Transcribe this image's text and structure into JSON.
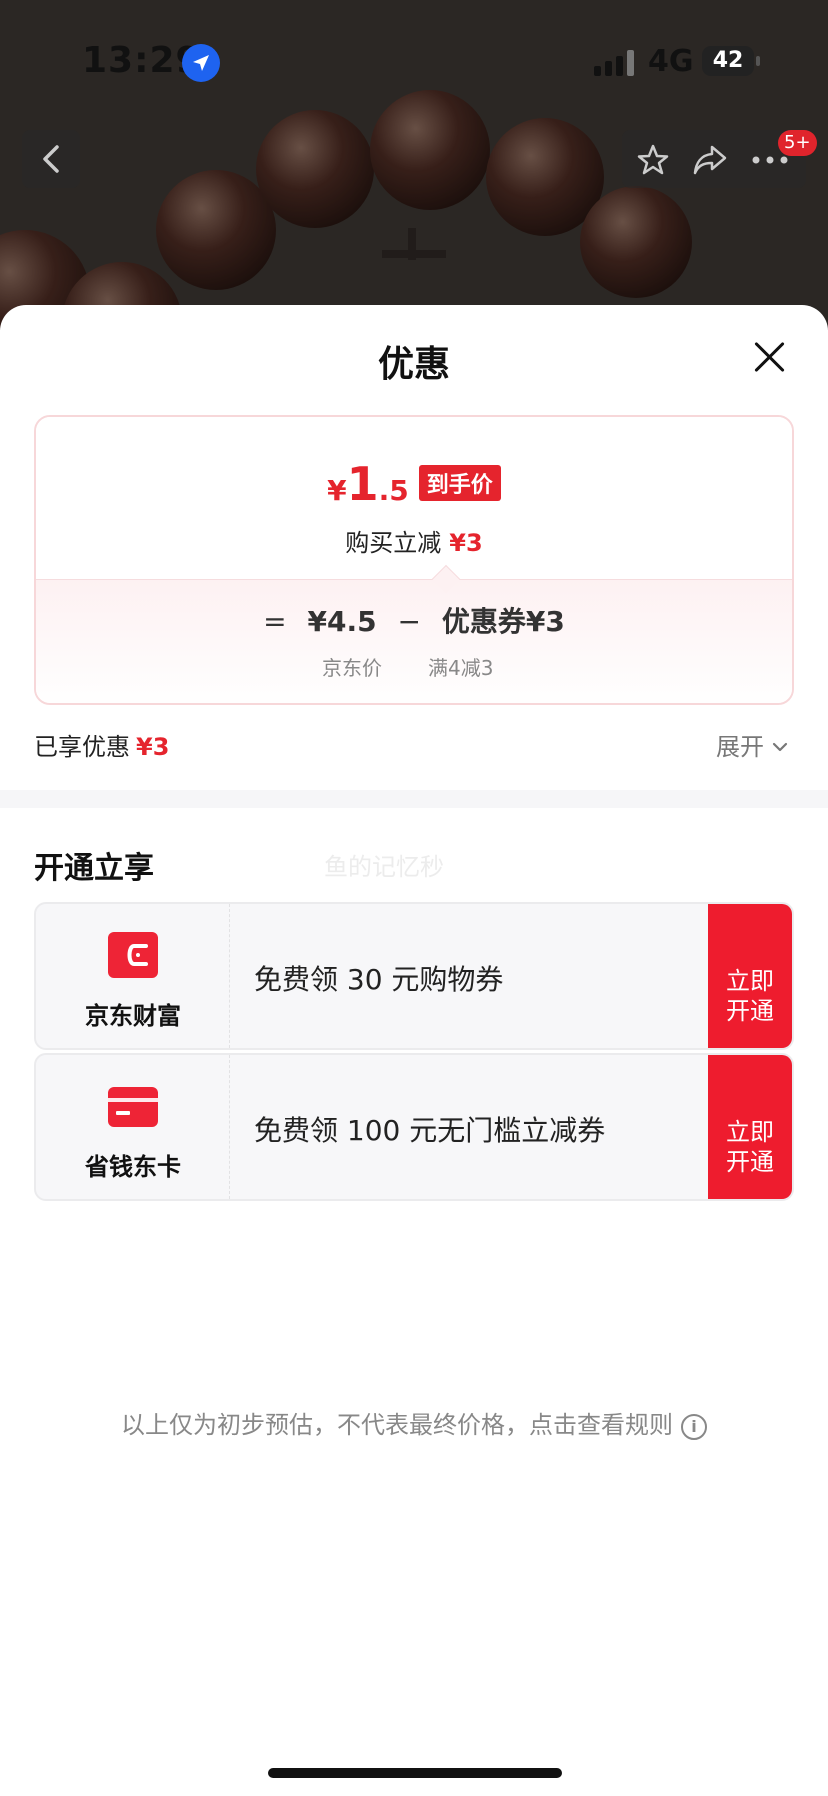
{
  "status_bar": {
    "time": "13:29",
    "network": "4G",
    "battery": "42"
  },
  "nav": {
    "badge": "5+"
  },
  "sheet": {
    "title": "优惠",
    "price": {
      "currency": "¥",
      "integer": "1",
      "decimal": ".5",
      "tag": "到手价",
      "save_label": "购买立减",
      "save_amount": "¥3"
    },
    "formula": {
      "equals": "=",
      "jd_price": "¥4.5",
      "minus": "−",
      "coupon": "优惠券¥3",
      "jd_price_label": "京东价",
      "coupon_rule": "满4减3"
    },
    "enjoyed": {
      "label": "已享优惠",
      "amount": "¥3"
    },
    "expand_label": "展开",
    "section_title": "开通立享",
    "watermark": "鱼的记忆秒",
    "benefits": [
      {
        "brand": "京东财富",
        "desc": "免费领 30 元购物券",
        "cta_line1": "立即",
        "cta_line2": "开通"
      },
      {
        "brand": "省钱东卡",
        "desc": "免费领 100 元无门槛立减券",
        "cta_line1": "立即",
        "cta_line2": "开通"
      }
    ],
    "footnote": "以上仅为初步预估，不代表最终价格，点击查看规则",
    "footnote_icon": "i"
  },
  "colors": {
    "accent": "#e5242d",
    "cta": "#ee1c2e"
  }
}
